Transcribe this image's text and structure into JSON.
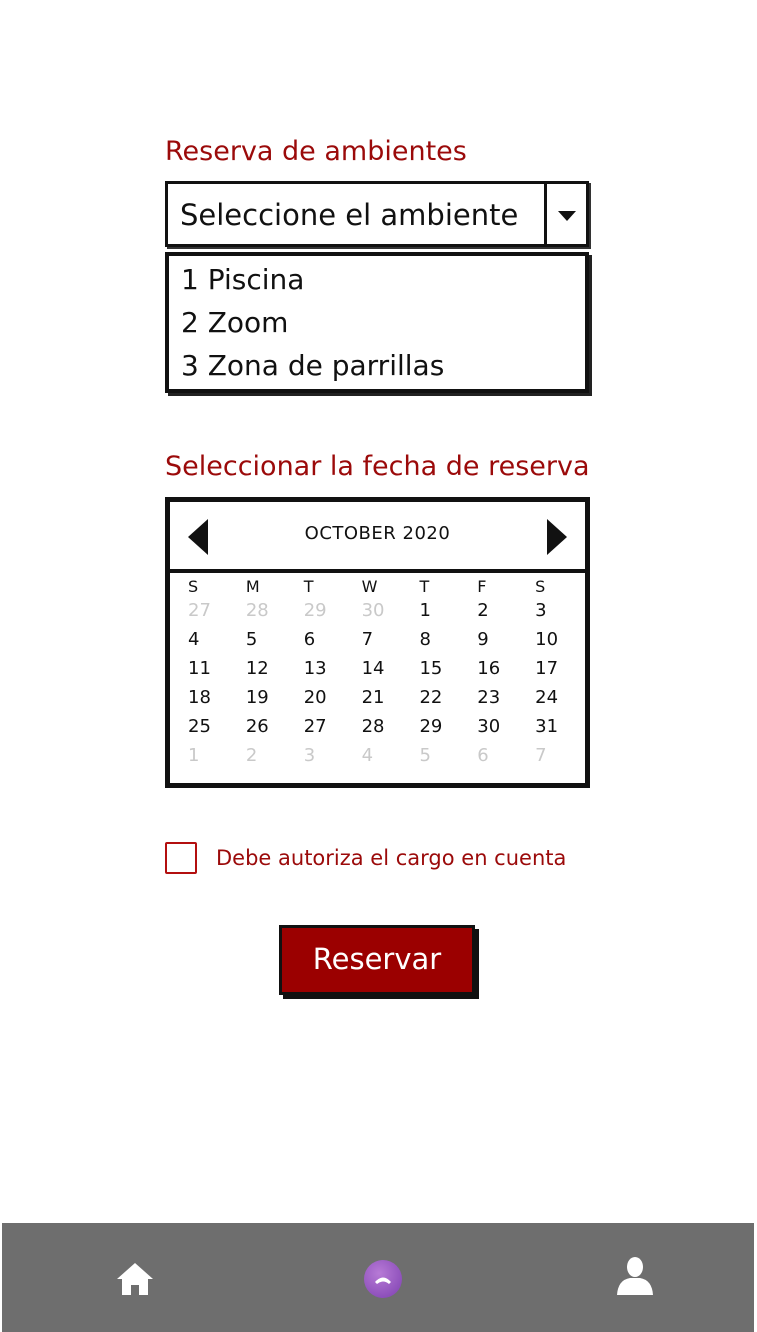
{
  "room_section": {
    "label": "Reserva de ambientes",
    "select_placeholder": "Seleccione el ambiente",
    "options": [
      "1 Piscina",
      "2 Zoom",
      "3 Zona de parrillas"
    ]
  },
  "date_section": {
    "label": "Seleccionar la fecha de reserva",
    "calendar": {
      "month_title": "OCTOBER 2020",
      "weekdays": [
        "S",
        "M",
        "T",
        "W",
        "T",
        "F",
        "S"
      ],
      "weeks": [
        [
          "27",
          "28",
          "29",
          "30",
          "1",
          "2",
          "3"
        ],
        [
          "4",
          "5",
          "6",
          "7",
          "8",
          "9",
          "10"
        ],
        [
          "11",
          "12",
          "13",
          "14",
          "15",
          "16",
          "17"
        ],
        [
          "18",
          "19",
          "20",
          "21",
          "22",
          "23",
          "24"
        ],
        [
          "25",
          "26",
          "27",
          "28",
          "29",
          "30",
          "31"
        ],
        [
          "1",
          "2",
          "3",
          "4",
          "5",
          "6",
          "7"
        ]
      ],
      "muted": [
        [
          true,
          true,
          true,
          true,
          false,
          false,
          false
        ],
        [
          false,
          false,
          false,
          false,
          false,
          false,
          false
        ],
        [
          false,
          false,
          false,
          false,
          false,
          false,
          false
        ],
        [
          false,
          false,
          false,
          false,
          false,
          false,
          false
        ],
        [
          false,
          false,
          false,
          false,
          false,
          false,
          false
        ],
        [
          true,
          true,
          true,
          true,
          true,
          true,
          true
        ]
      ]
    }
  },
  "authorization": {
    "checkbox_label": "Debe autoriza el cargo en cuenta",
    "checked": false
  },
  "actions": {
    "reserve_label": "Reservar"
  },
  "bottom_nav": {
    "items": [
      {
        "icon": "home-icon"
      },
      {
        "icon": "phone-icon"
      },
      {
        "icon": "user-icon"
      }
    ]
  },
  "colors": {
    "accent_red": "#9b0a0a",
    "button_bg": "#9b0000",
    "nav_bg": "#6e6e6e",
    "call_purple": "#8a4bc0"
  }
}
